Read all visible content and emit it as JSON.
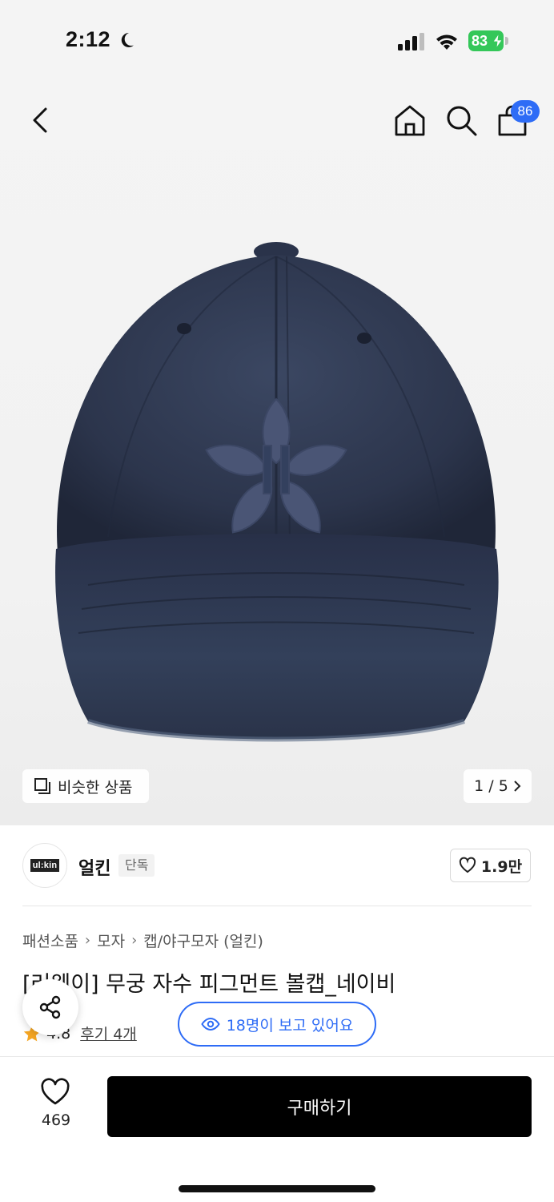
{
  "status_bar": {
    "time": "2:12",
    "battery": "83"
  },
  "nav": {
    "cart_count": "86"
  },
  "gallery": {
    "similar_label": "비슷한 상품",
    "page_indicator": "1 / 5"
  },
  "brand": {
    "logo_text": "ul:kin",
    "name": "얼킨",
    "tag": "단독",
    "like_count": "1.9만"
  },
  "product": {
    "breadcrumb": [
      "패션소품",
      "모자",
      "캡/야구모자 (얼킨)"
    ],
    "title": "[러웨이] 무궁 자수 피그먼트 볼캡_네이비",
    "rating": "4.8",
    "reviews": "후기 4개",
    "viewers": "18명이 보고 있어요"
  },
  "bottom_bar": {
    "wish_count": "469",
    "buy_label": "구매하기"
  },
  "colors": {
    "accent_blue": "#2e6cf6",
    "battery_green": "#34c759",
    "star_orange": "#f5a623",
    "cap_navy": "#2f3a52"
  }
}
